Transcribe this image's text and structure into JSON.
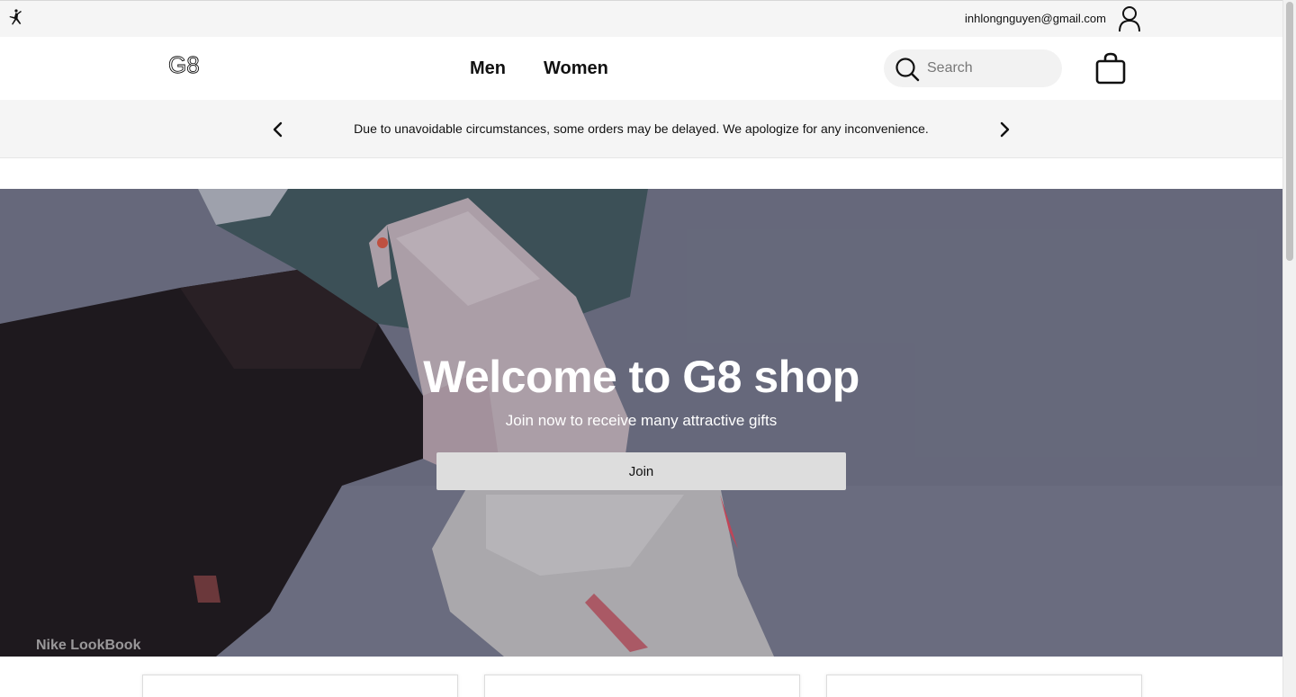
{
  "header": {
    "user_email": "inhlongnguyen@gmail.com"
  },
  "nav": {
    "brand": "G8",
    "links": [
      "Men",
      "Women"
    ],
    "search_placeholder": "Search"
  },
  "announcement": {
    "text": "Due to unavoidable circumstances, some orders may be delayed. We apologize for any inconvenience."
  },
  "hero": {
    "title": "Welcome to G8 shop",
    "subtitle": "Join now to receive many attractive gifts",
    "button_label": "Join",
    "credit": "Nike LookBook"
  },
  "icons": {
    "jordan": "jumpman-logo-icon",
    "user": "user-icon",
    "search": "search-icon",
    "bag": "shopping-bag-icon",
    "prev": "chevron-left-icon",
    "next": "chevron-right-icon"
  },
  "colors": {
    "accent": "#111111",
    "hero_bg": "#6b6e7c",
    "button_bg": "#dddddd"
  }
}
